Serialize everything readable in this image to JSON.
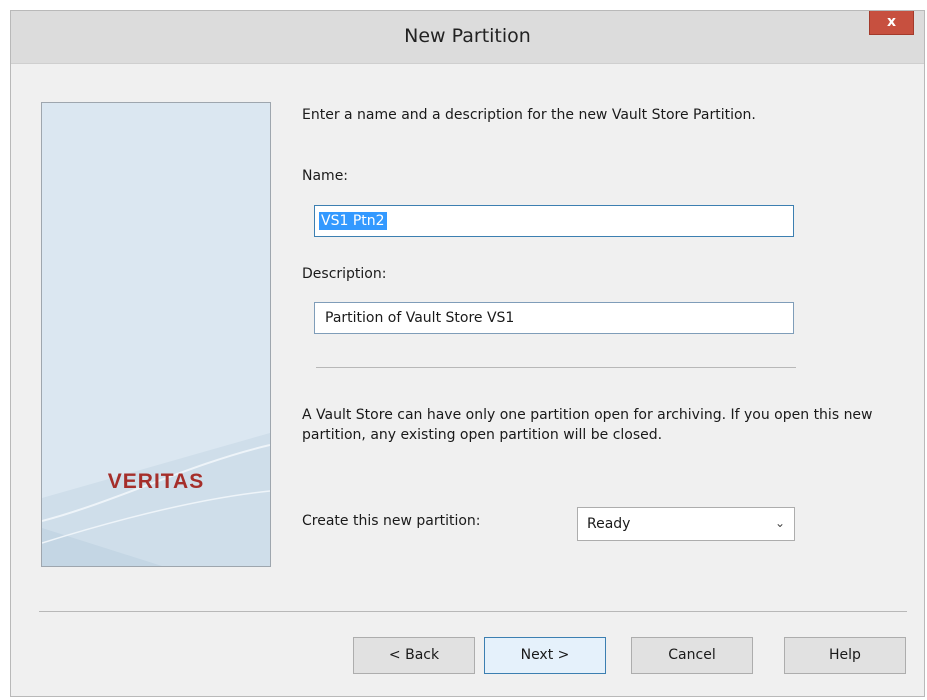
{
  "window": {
    "title": "New Partition",
    "close_label": "x"
  },
  "branding": {
    "logo_text": "VERITAS",
    "logo_color": "#a52e2a"
  },
  "form": {
    "intro": "Enter a name and a description for the new Vault Store Partition.",
    "name_label": "Name:",
    "name_value": "VS1 Ptn2",
    "description_label": "Description:",
    "description_value": "Partition of Vault Store VS1",
    "warning": "A Vault Store can have only one partition open for archiving. If you open this new partition, any existing open partition will be closed.",
    "create_label": "Create this new partition:",
    "create_value": "Ready"
  },
  "buttons": {
    "back": "< Back",
    "next": "Next >",
    "cancel": "Cancel",
    "help": "Help"
  },
  "icons": {
    "close": "close-icon",
    "dropdown": "chevron-down-icon"
  },
  "colors": {
    "selection": "#3399ff",
    "close_button": "#c7503f",
    "focus_border": "#3c7fb1"
  }
}
